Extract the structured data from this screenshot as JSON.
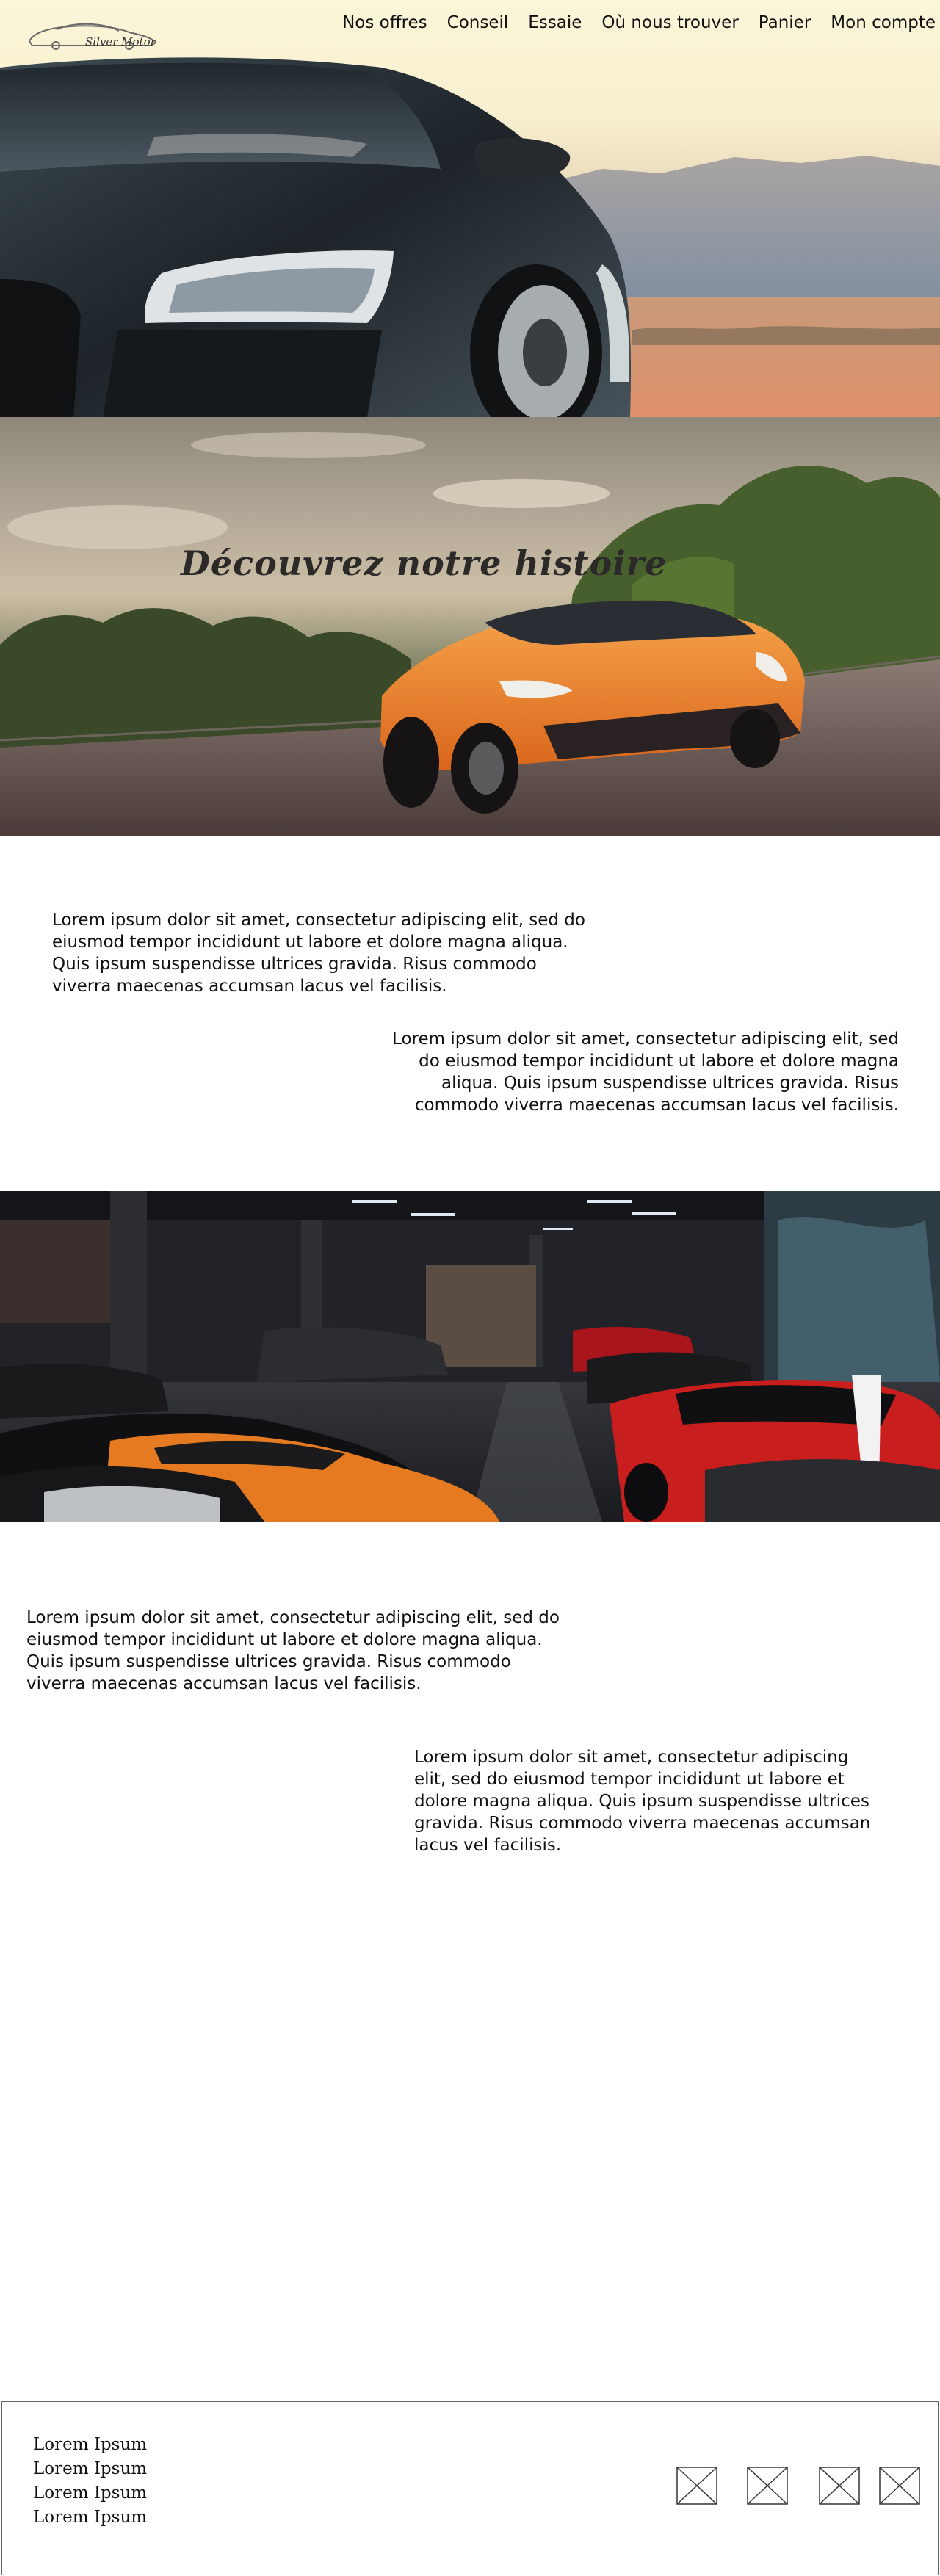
{
  "brand": {
    "name": "Silver Motor"
  },
  "nav": {
    "items": [
      "Nos offres",
      "Conseil",
      "Essaie",
      "Où nous trouver",
      "Panier",
      "Mon compte"
    ]
  },
  "story": {
    "title": "Découvrez notre histoire"
  },
  "paragraphs": [
    "Lorem ipsum dolor sit amet, consectetur adipiscing elit, sed do eiusmod tempor incididunt ut labore et dolore magna aliqua. Quis ipsum suspendisse ultrices gravida. Risus commodo viverra maecenas accumsan lacus vel facilisis.",
    "Lorem ipsum dolor sit amet, consectetur adipiscing elit, sed do eiusmod tempor incididunt ut labore et dolore magna aliqua. Quis ipsum suspendisse ultrices gravida. Risus commodo viverra maecenas accumsan lacus vel facilisis.",
    "Lorem ipsum dolor sit amet, consectetur adipiscing elit, sed do eiusmod tempor incididunt ut labore et dolore magna aliqua. Quis ipsum suspendisse ultrices gravida. Risus commodo viverra maecenas accumsan lacus vel facilisis.",
    "Lorem ipsum dolor sit amet, consectetur adipiscing elit, sed do eiusmod tempor incididunt ut labore et dolore magna aliqua. Quis ipsum suspendisse ultrices gravida. Risus commodo viverra maecenas accumsan lacus vel facilisis."
  ],
  "footer": {
    "links": [
      "Lorem Ipsum",
      "Lorem Ipsum",
      "Lorem Ipsum",
      "Lorem Ipsum"
    ],
    "social_icons": [
      "image-placeholder-icon",
      "image-placeholder-icon",
      "image-placeholder-icon",
      "image-placeholder-icon"
    ]
  },
  "colors": {
    "hero_sky": "#fbf6d9",
    "orange_car": "#f08a24",
    "red_car": "#c81e1e",
    "text": "#111111"
  }
}
